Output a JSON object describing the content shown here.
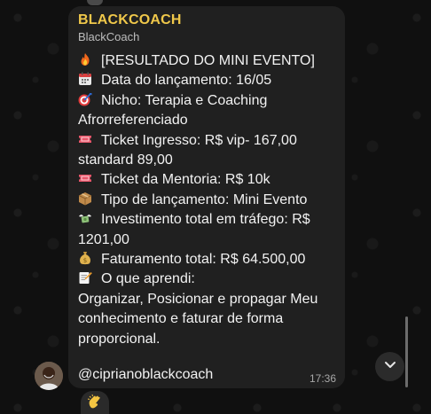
{
  "message": {
    "sender": "BLACKCOACH",
    "sender_subtitle": "BlackCoach",
    "lines": [
      "[RESULTADO DO MINI EVENTO]",
      "Data do lançamento: 16/05",
      "Nicho: Terapia e Coaching",
      "Afrorreferenciado",
      "Ticket Ingresso: R$ vip- 167,00",
      "standard 89,00",
      "Ticket da Mentoria: R$ 10k",
      "Tipo de lançamento: Mini Evento",
      "Investimento total em tráfego: R$",
      "1201,00",
      "Faturamento total: R$ 64.500,00",
      "O que aprendi:",
      "Organizar, Posicionar e propagar Meu",
      "conhecimento e faturar de forma",
      "proporcional."
    ],
    "icons": {
      "0": "fire-icon",
      "1": "calendar-icon",
      "2": "target-icon",
      "4": "ticket-icon",
      "6": "ticket-icon",
      "7": "package-icon",
      "8": "money-wings-icon",
      "10": "money-bag-icon",
      "11": "memo-icon"
    },
    "handle": "@ciprianoblackcoach",
    "time": "17:36",
    "reaction_icon": "clap-icon"
  },
  "colors": {
    "sender": "#f0c84a",
    "bubble": "#202020",
    "text": "#f2f2f2"
  }
}
